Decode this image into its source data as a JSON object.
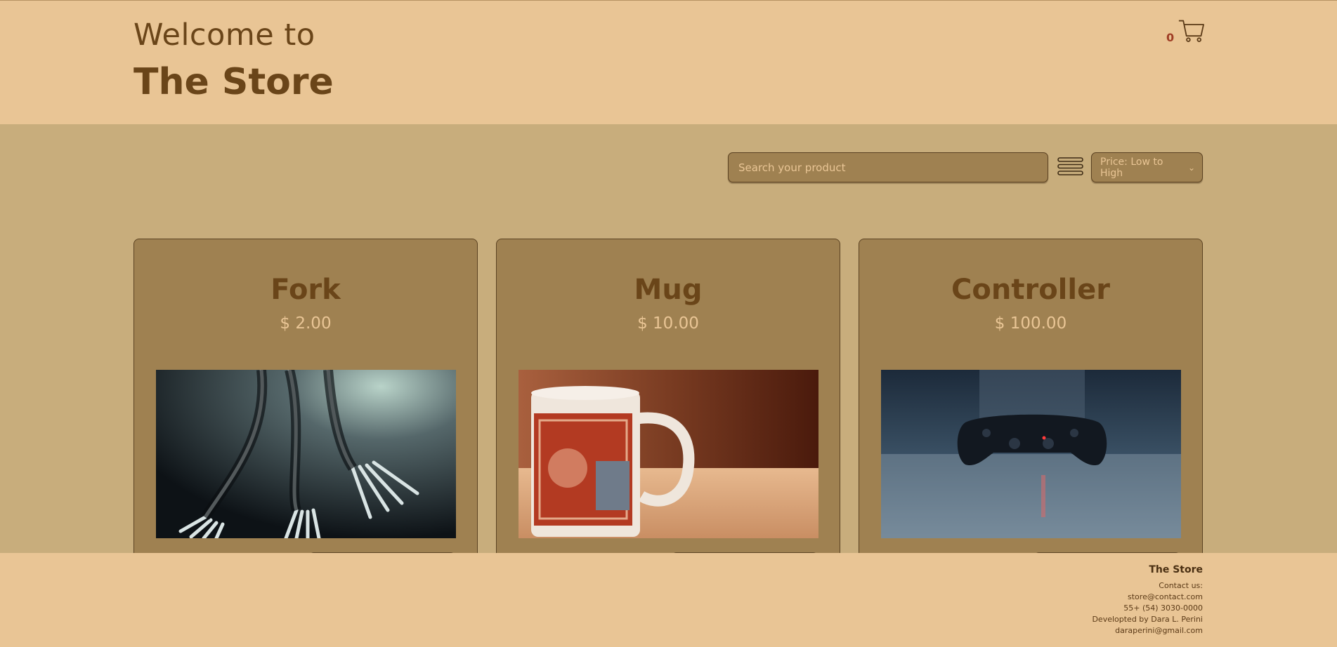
{
  "header": {
    "welcome": "Welcome to",
    "title": "The Store",
    "cart_count": "0",
    "cart_icon": "cart-icon"
  },
  "controls": {
    "search_placeholder": "Search your product",
    "menu_icon": "hamburger-icon",
    "sort_value": "Price: Low to High"
  },
  "products": [
    {
      "name": "Fork",
      "price": "$ 2.00",
      "image": "photo-forks"
    },
    {
      "name": "Mug",
      "price": "$ 10.00",
      "image": "photo-mug"
    },
    {
      "name": "Controller",
      "price": "$ 100.00",
      "image": "photo-controller"
    }
  ],
  "footer": {
    "title": "The Store",
    "contact_label": "Contact us:",
    "email": "store@contact.com",
    "phone": "55+ (54) 3030-0000",
    "developer": "Developted by Dara L. Perini",
    "developer_email": "daraperini@gmail.com"
  },
  "colors": {
    "header_bg": "#e9c595",
    "body_bg": "#c8ad7c",
    "card_bg": "#9f8151",
    "text_dark": "#6a4519",
    "text_light": "#e9c595",
    "cart_count": "#9f3d25"
  }
}
